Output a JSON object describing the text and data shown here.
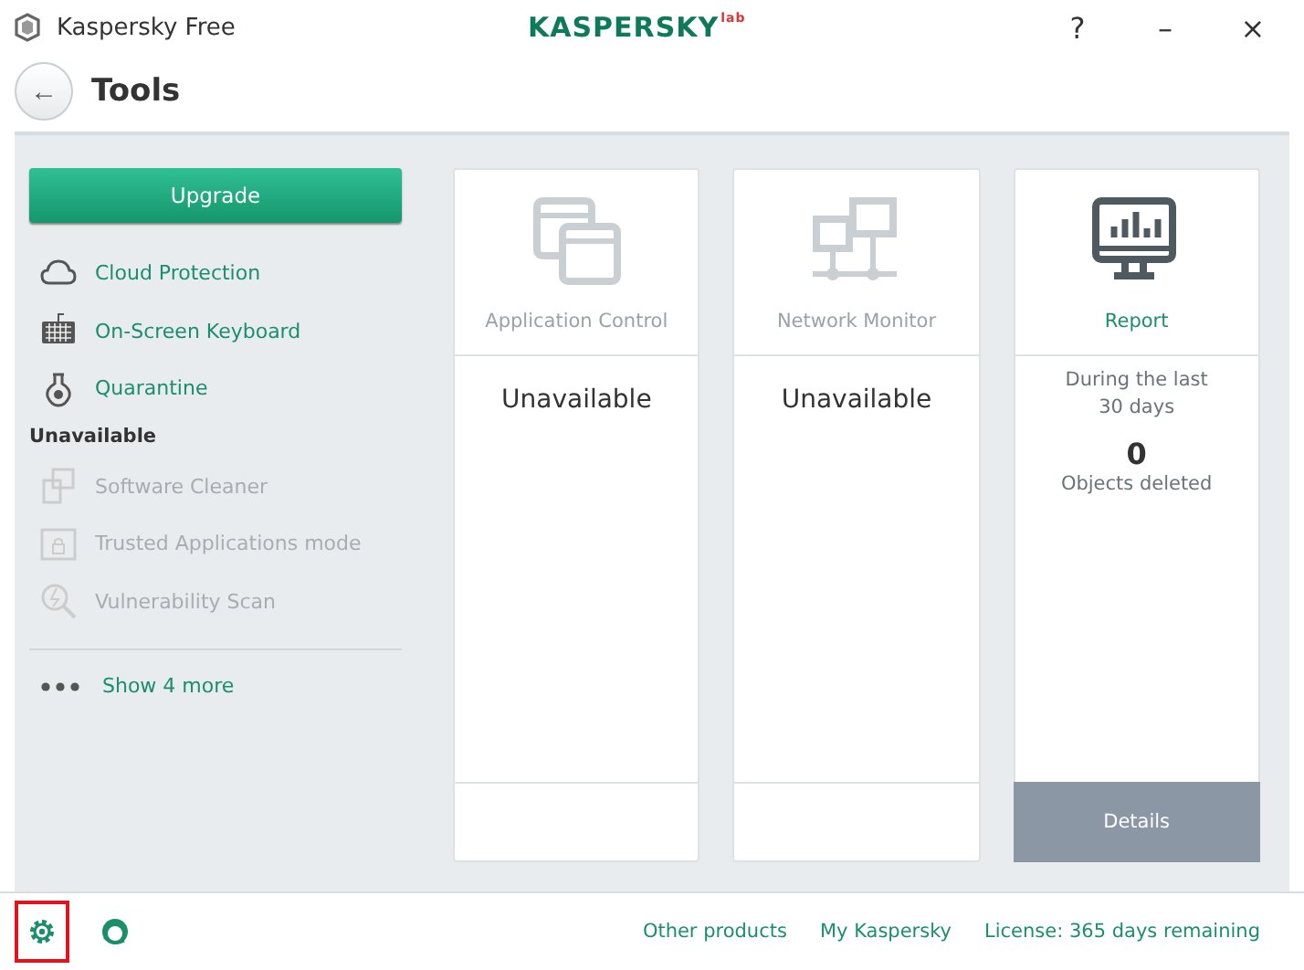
{
  "window": {
    "title": "Kaspersky Free",
    "logo": "KASPERSKY",
    "logo_suffix": "lab",
    "controls": [
      "?",
      "–",
      "×"
    ]
  },
  "header": {
    "back": "←",
    "title": "Tools"
  },
  "sidebar": {
    "upgrade_button": "Upgrade",
    "tools": [
      {
        "label": "Cloud Protection",
        "disabled": false
      },
      {
        "label": "On-Screen Keyboard",
        "disabled": false
      },
      {
        "label": "Quarantine",
        "disabled": false
      }
    ],
    "unavailable_heading": "Unavailable",
    "unavailable_tools": [
      {
        "label": "Software Cleaner",
        "disabled": true
      },
      {
        "label": "Trusted Applications mode",
        "disabled": true
      },
      {
        "label": "Vulnerability Scan",
        "disabled": true
      }
    ],
    "show_more": "Show 4 more"
  },
  "cards": [
    {
      "kind": "unavailable",
      "title": "Application Control",
      "disabled": true,
      "status": "Unavailable"
    },
    {
      "kind": "unavailable",
      "title": "Network Monitor",
      "disabled": true,
      "status": "Unavailable"
    },
    {
      "kind": "report",
      "title": "Report",
      "disabled": false,
      "caption": "During the last 30 days",
      "count": "0",
      "count_label": "Objects deleted",
      "button": "Details"
    }
  ],
  "footer": {
    "settings_highlighted": true,
    "links": [
      "Other products",
      "My Kaspersky",
      "License: 365 days remaining"
    ]
  }
}
